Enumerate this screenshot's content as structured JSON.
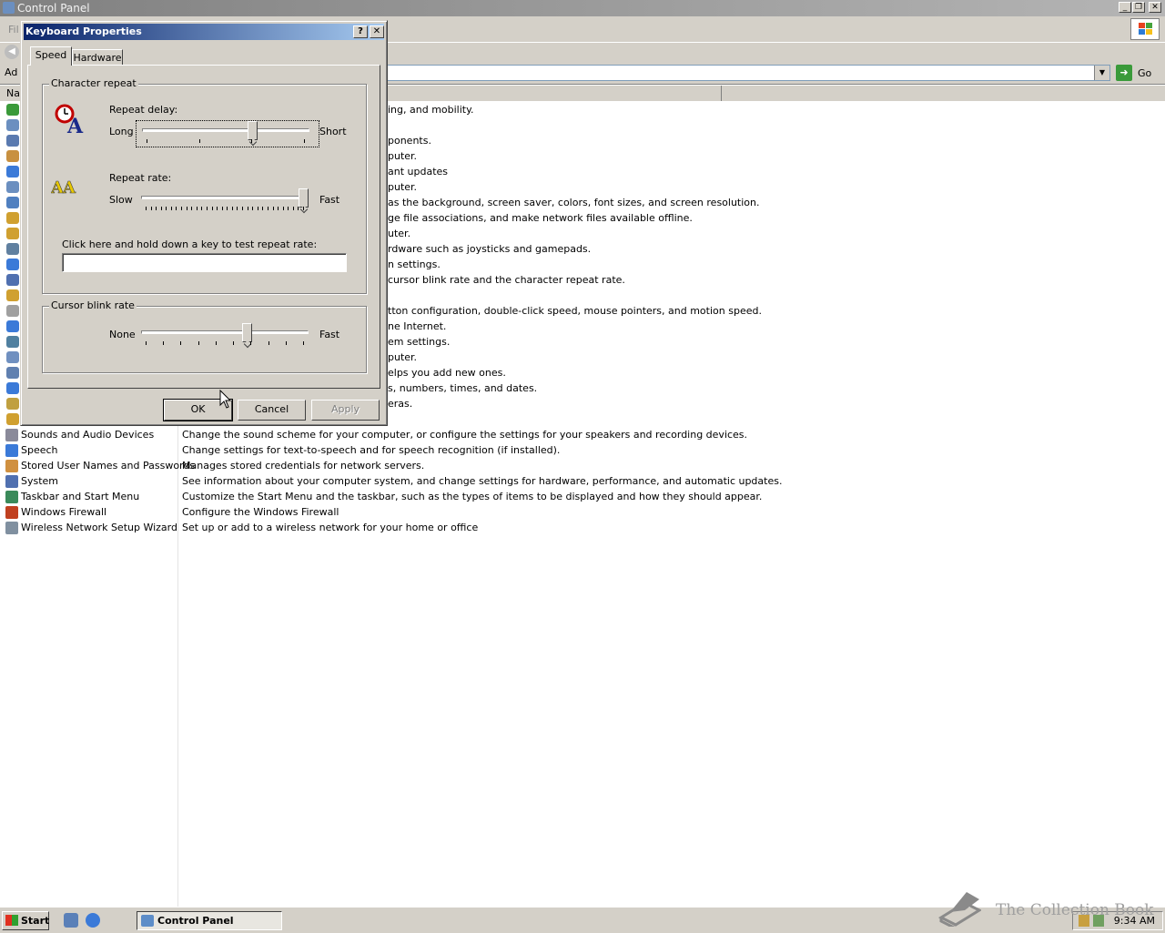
{
  "window": {
    "title": "Control Panel"
  },
  "menubar": {
    "file_partial": "Fil"
  },
  "address": {
    "label_partial": "Ad",
    "go": "Go"
  },
  "column_header": {
    "name_partial": "Na"
  },
  "items": [
    {
      "name": "Sounds and Audio Devices",
      "desc": "Change the sound scheme for your computer, or configure the settings for your speakers and recording devices."
    },
    {
      "name": "Speech",
      "desc": "Change settings for text-to-speech and for speech recognition (if installed)."
    },
    {
      "name": "Stored User Names and Passwords",
      "desc": "Manages stored credentials for network servers."
    },
    {
      "name": "System",
      "desc": "See information about your computer system, and change settings for hardware, performance, and automatic updates."
    },
    {
      "name": "Taskbar and Start Menu",
      "desc": "Customize the Start Menu and the taskbar, such as the types of items to be displayed and how they should appear."
    },
    {
      "name": "Windows Firewall",
      "desc": "Configure the Windows Firewall"
    },
    {
      "name": "Wireless Network Setup Wizard",
      "desc": "Set up or add to a wireless network for your home or office"
    }
  ],
  "partial_descs": [
    "ing, and mobility.",
    "",
    "ponents.",
    "puter.",
    "ant updates",
    "puter.",
    " as the background, screen saver, colors, font sizes, and screen resolution.",
    "ge file associations, and make network files available offline.",
    "uter.",
    "rdware such as joysticks and gamepads.",
    "n settings.",
    " cursor blink rate and the character repeat rate.",
    "",
    "tton configuration, double-click speed, mouse pointers, and motion speed.",
    "ne Internet.",
    "em settings.",
    "puter.",
    "elps you add new ones.",
    "s, numbers, times, and dates.",
    "eras."
  ],
  "dialog": {
    "title": "Keyboard Properties",
    "help": "?",
    "close": "✕",
    "tabs": {
      "speed": "Speed",
      "hardware": "Hardware"
    },
    "character_repeat": {
      "group_title": "Character repeat",
      "repeat_delay_label": "Repeat delay:",
      "delay_left": "Long",
      "delay_right": "Short",
      "delay_value": 0.67,
      "repeat_rate_label": "Repeat rate:",
      "rate_left": "Slow",
      "rate_right": "Fast",
      "rate_value": 1.0,
      "test_label": "Click here and hold down a key to test repeat rate:",
      "test_value": ""
    },
    "cursor_blink": {
      "group_title": "Cursor blink rate",
      "left": "None",
      "right": "Fast",
      "value": 0.64
    },
    "buttons": {
      "ok": "OK",
      "cancel": "Cancel",
      "apply": "Apply"
    }
  },
  "taskbar": {
    "start": "Start",
    "task": "Control Panel",
    "clock": "9:34 AM"
  },
  "watermark": "The Collection Book"
}
